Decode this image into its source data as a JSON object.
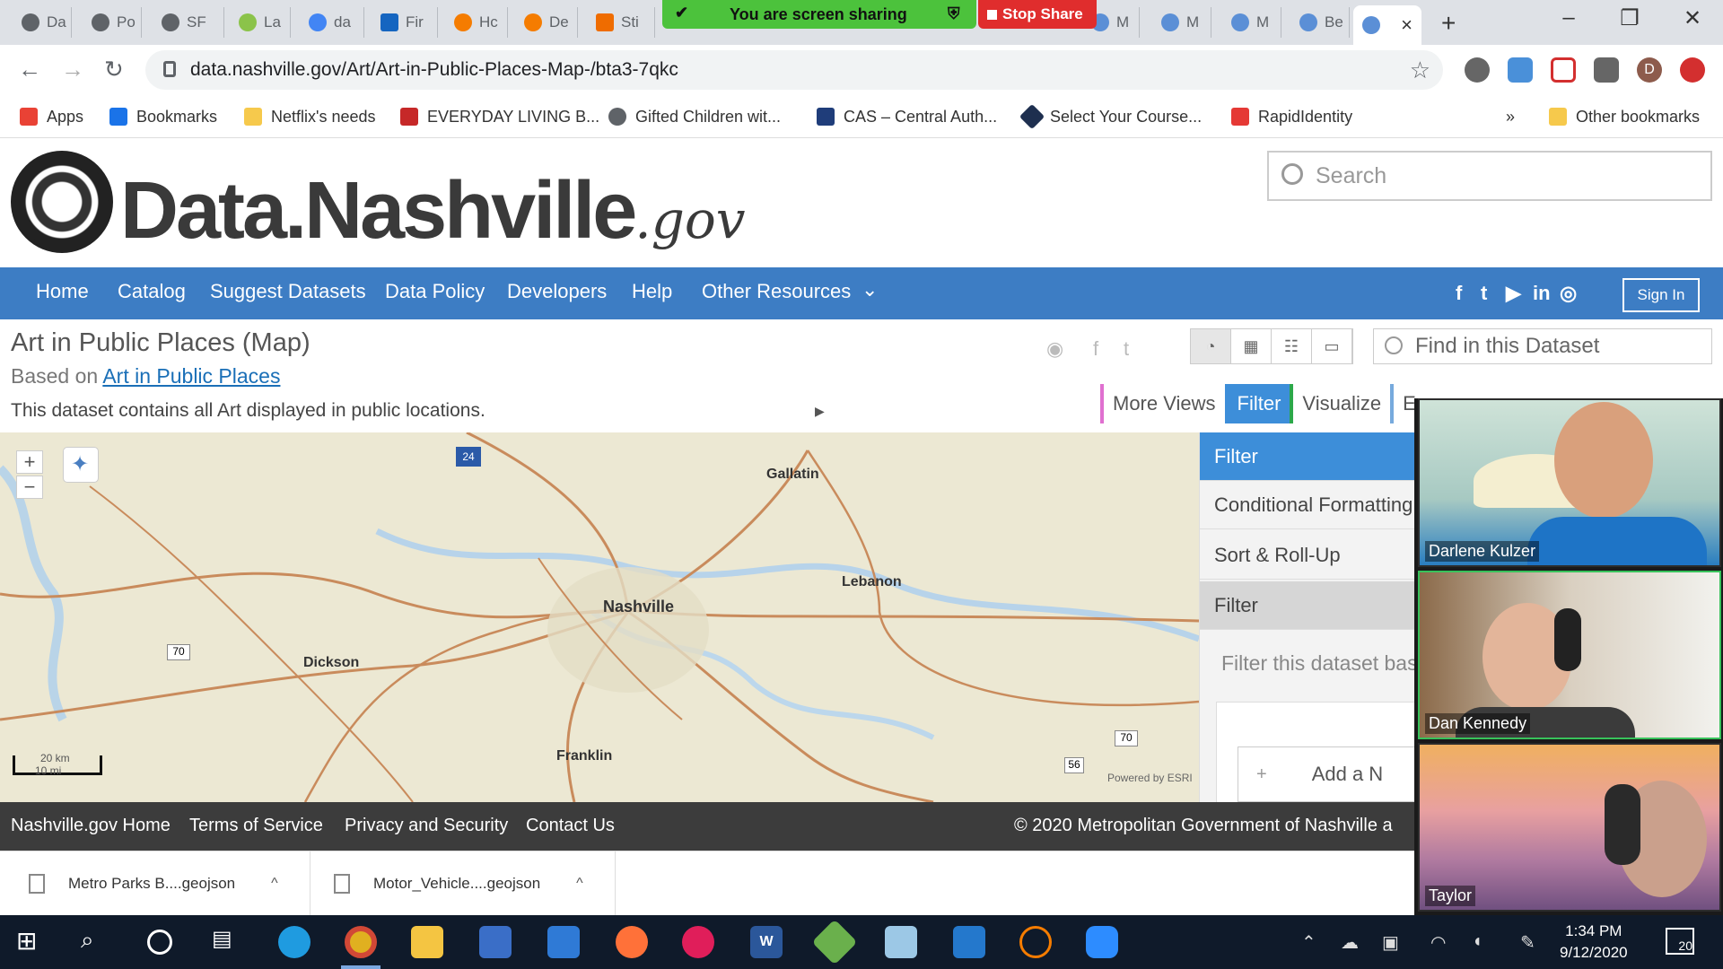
{
  "browser": {
    "tabs": [
      {
        "label": "Da"
      },
      {
        "label": "Po"
      },
      {
        "label": "SF"
      },
      {
        "label": "La"
      },
      {
        "label": "da"
      },
      {
        "label": "Fir"
      },
      {
        "label": "Hc"
      },
      {
        "label": "De"
      },
      {
        "label": "Sti"
      },
      {
        "label": "M"
      },
      {
        "label": "M"
      },
      {
        "label": "M"
      },
      {
        "label": "Be"
      }
    ],
    "active_tab_close": "×",
    "new_tab": "+",
    "url": "data.nashville.gov/Art/Art-in-Public-Places-Map-/bta3-7qkc",
    "profile_initial": "D"
  },
  "zoom_share": {
    "status": "You are screen sharing",
    "stop_label": "Stop Share"
  },
  "bookmarks": [
    {
      "label": "Apps",
      "color": "#e94235"
    },
    {
      "label": "Bookmarks",
      "color": "#1a73e8"
    },
    {
      "label": "Netflix's needs",
      "color": "#f6c94c"
    },
    {
      "label": "EVERYDAY LIVING B...",
      "color": "#c62828"
    },
    {
      "label": "Gifted Children wit...",
      "color": "#5f6368"
    },
    {
      "label": "CAS – Central Auth...",
      "color": "#1f3d7a"
    },
    {
      "label": "Select Your Course...",
      "color": "#1e2f4f"
    },
    {
      "label": "RapidIdentity",
      "color": "#e53935"
    }
  ],
  "bookmarks_more": "»",
  "bookmarks_other": "Other bookmarks",
  "site": {
    "logo_main": "Data.Nashville",
    "logo_suffix": ".gov",
    "search_placeholder": "Search",
    "nav": [
      "Home",
      "Catalog",
      "Suggest Datasets",
      "Data Policy",
      "Developers",
      "Help",
      "Other Resources"
    ],
    "nav_more": "⌄",
    "social": [
      "f",
      "t",
      "▶",
      "in",
      "◎"
    ],
    "sign_in": "Sign In"
  },
  "dataset": {
    "title": "Art in Public Places (Map)",
    "based_on_prefix": "Based on",
    "based_on_link": "Art in Public Places",
    "description": "This dataset contains all Art displayed in public locations.",
    "find_placeholder": "Find in this Dataset",
    "tabs": [
      "More Views",
      "Filter",
      "Visualize",
      "Ex"
    ]
  },
  "map": {
    "cities": [
      {
        "name": "Gallatin"
      },
      {
        "name": "Lebanon"
      },
      {
        "name": "Nashville"
      },
      {
        "name": "Dickson"
      },
      {
        "name": "Franklin"
      }
    ],
    "shields": [
      "24",
      "70",
      "70",
      "56"
    ],
    "scale_km": "20 km",
    "scale_mi": "10 mi",
    "attribution": "Powered by ESRI",
    "zoom_in": "+",
    "zoom_out": "−"
  },
  "filter_panel": {
    "header": "Filter",
    "items": [
      "Conditional Formatting",
      "Sort & Roll-Up",
      "Filter"
    ],
    "hint": "Filter this dataset bas",
    "add_button": "Add a N",
    "add_plus": "+"
  },
  "footer": {
    "links": [
      "Nashville.gov Home",
      "Terms of Service",
      "Privacy and Security",
      "Contact Us"
    ],
    "copyright": "© 2020 Metropolitan Government of Nashville a"
  },
  "downloads": [
    {
      "name": "Metro Parks B....geojson"
    },
    {
      "name": "Motor_Vehicle....geojson"
    }
  ],
  "download_chevron": "^",
  "zoom_participants": [
    {
      "name": "Darlene Kulzer"
    },
    {
      "name": "Dan Kennedy"
    },
    {
      "name": "Taylor"
    }
  ],
  "taskbar": {
    "time": "1:34 PM",
    "date": "9/12/2020",
    "notifications": "20"
  },
  "colors": {
    "nav_blue": "#3d7dc4",
    "filter_blue": "#3d8ed9",
    "share_green": "#4cc23c",
    "stop_red": "#e02d2d"
  }
}
